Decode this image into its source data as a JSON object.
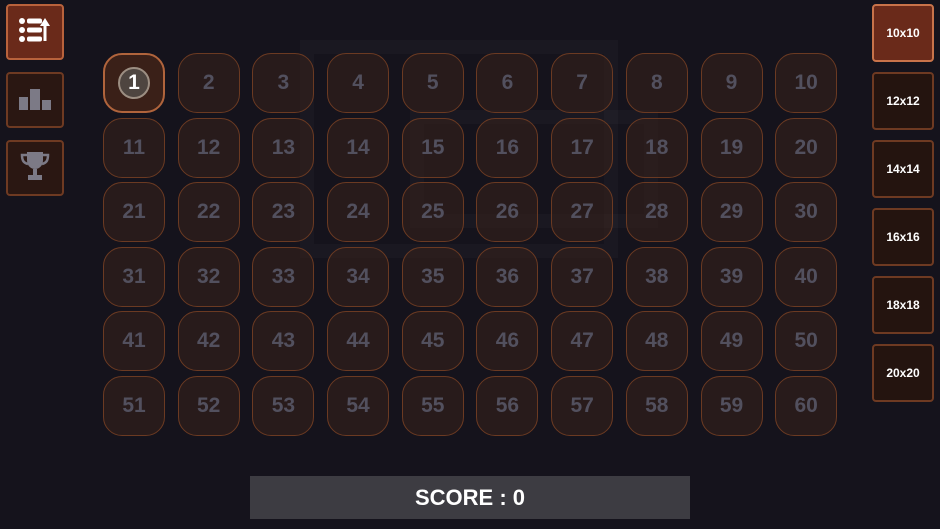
{
  "left_buttons": [
    {
      "icon": "menu-back-icon",
      "active": true
    },
    {
      "icon": "leaderboard-icon",
      "active": false
    },
    {
      "icon": "trophy-icon",
      "active": false
    }
  ],
  "grid": {
    "columns": 10,
    "rows": 6,
    "current_level": 1,
    "levels": [
      1,
      2,
      3,
      4,
      5,
      6,
      7,
      8,
      9,
      10,
      11,
      12,
      13,
      14,
      15,
      16,
      17,
      18,
      19,
      20,
      21,
      22,
      23,
      24,
      25,
      26,
      27,
      28,
      29,
      30,
      31,
      32,
      33,
      34,
      35,
      36,
      37,
      38,
      39,
      40,
      41,
      42,
      43,
      44,
      45,
      46,
      47,
      48,
      49,
      50,
      51,
      52,
      53,
      54,
      55,
      56,
      57,
      58,
      59,
      60
    ]
  },
  "board_sizes": [
    {
      "label": "10x10",
      "active": true
    },
    {
      "label": "12x12",
      "active": false
    },
    {
      "label": "14x14",
      "active": false
    },
    {
      "label": "16x16",
      "active": false
    },
    {
      "label": "18x18",
      "active": false
    },
    {
      "label": "20x20",
      "active": false
    }
  ],
  "score": {
    "label": "SCORE : 0"
  },
  "colors": {
    "background": "#15131c",
    "accent": "#6a2a1a",
    "cell_border": "#6b3a22",
    "locked_text": "#52505e",
    "score_bar": "#3d3c42"
  }
}
